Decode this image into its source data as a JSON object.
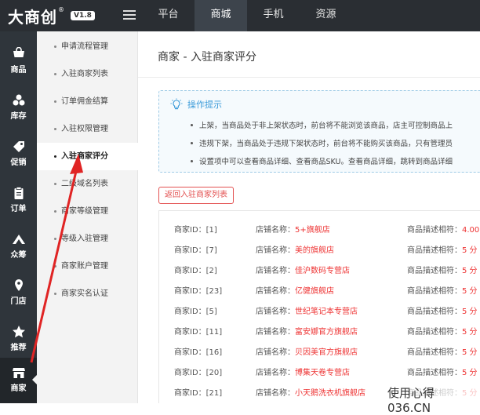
{
  "app": {
    "logo_text": "大商创",
    "logo_mark": "®",
    "version": "V1.8"
  },
  "topnav": {
    "items": [
      {
        "label": "平台"
      },
      {
        "label": "商城"
      },
      {
        "label": "手机"
      },
      {
        "label": "资源"
      }
    ],
    "active": 1
  },
  "sidebar": {
    "items": [
      {
        "label": "商品",
        "icon": "cart-icon"
      },
      {
        "label": "库存",
        "icon": "cubes-icon"
      },
      {
        "label": "促销",
        "icon": "tag-icon"
      },
      {
        "label": "订单",
        "icon": "clipboard-icon"
      },
      {
        "label": "众筹",
        "icon": "crowdfund-icon"
      },
      {
        "label": "门店",
        "icon": "location-pin-icon"
      },
      {
        "label": "推荐",
        "icon": "star-icon"
      },
      {
        "label": "商家",
        "icon": "store-icon"
      }
    ],
    "active": 7
  },
  "submenu": {
    "items": [
      {
        "label": "申请流程管理"
      },
      {
        "label": "入驻商家列表"
      },
      {
        "label": "订单佣金结算"
      },
      {
        "label": "入驻权限管理"
      },
      {
        "label": "入驻商家评分"
      },
      {
        "label": "二级域名列表"
      },
      {
        "label": "商家等级管理"
      },
      {
        "label": "等级入驻管理"
      },
      {
        "label": "商家账户管理"
      },
      {
        "label": "商家实名认证"
      }
    ],
    "active": 4
  },
  "page": {
    "title": "商家 - 入驻商家评分"
  },
  "tips": {
    "title": "操作提示",
    "lines": [
      "上架，当商品处于非上架状态时，前台将不能浏览该商品，店主可控制商品上",
      "违规下架，当商品处于违规下架状态时，前台将不能购买该商品，只有管理员",
      "设置项中可以查看商品详细、查看商品SKU。查看商品详细，跳转到商品详细"
    ]
  },
  "back_button": {
    "label": "返回入驻商家列表"
  },
  "list": {
    "id_label": "商家ID：",
    "store_label": "店铺名称：",
    "score_label": "商品描述相符：",
    "rows": [
      {
        "id": "[1]",
        "store": "5+旗舰店",
        "score": "4.00"
      },
      {
        "id": "[7]",
        "store": "美的旗舰店",
        "score": "5 分"
      },
      {
        "id": "[2]",
        "store": "佳沪数码专营店",
        "score": "5 分"
      },
      {
        "id": "[23]",
        "store": "亿健旗舰店",
        "score": "5 分"
      },
      {
        "id": "[5]",
        "store": "世纪笔记本专营店",
        "score": "5 分"
      },
      {
        "id": "[11]",
        "store": "富安娜官方旗舰店",
        "score": "5 分"
      },
      {
        "id": "[16]",
        "store": "贝因美官方旗舰店",
        "score": "5 分"
      },
      {
        "id": "[20]",
        "store": "博集天卷专营店",
        "score": "5 分"
      },
      {
        "id": "[21]",
        "store": "小天鹅洗衣机旗舰店",
        "score": "5 分"
      }
    ]
  },
  "watermark": "使用心得 036.CN",
  "colors": {
    "topbar": "#2a2e33",
    "sidebar": "#2f353b",
    "accent_red": "#e33333",
    "tips_blue": "#3a9ad9"
  }
}
